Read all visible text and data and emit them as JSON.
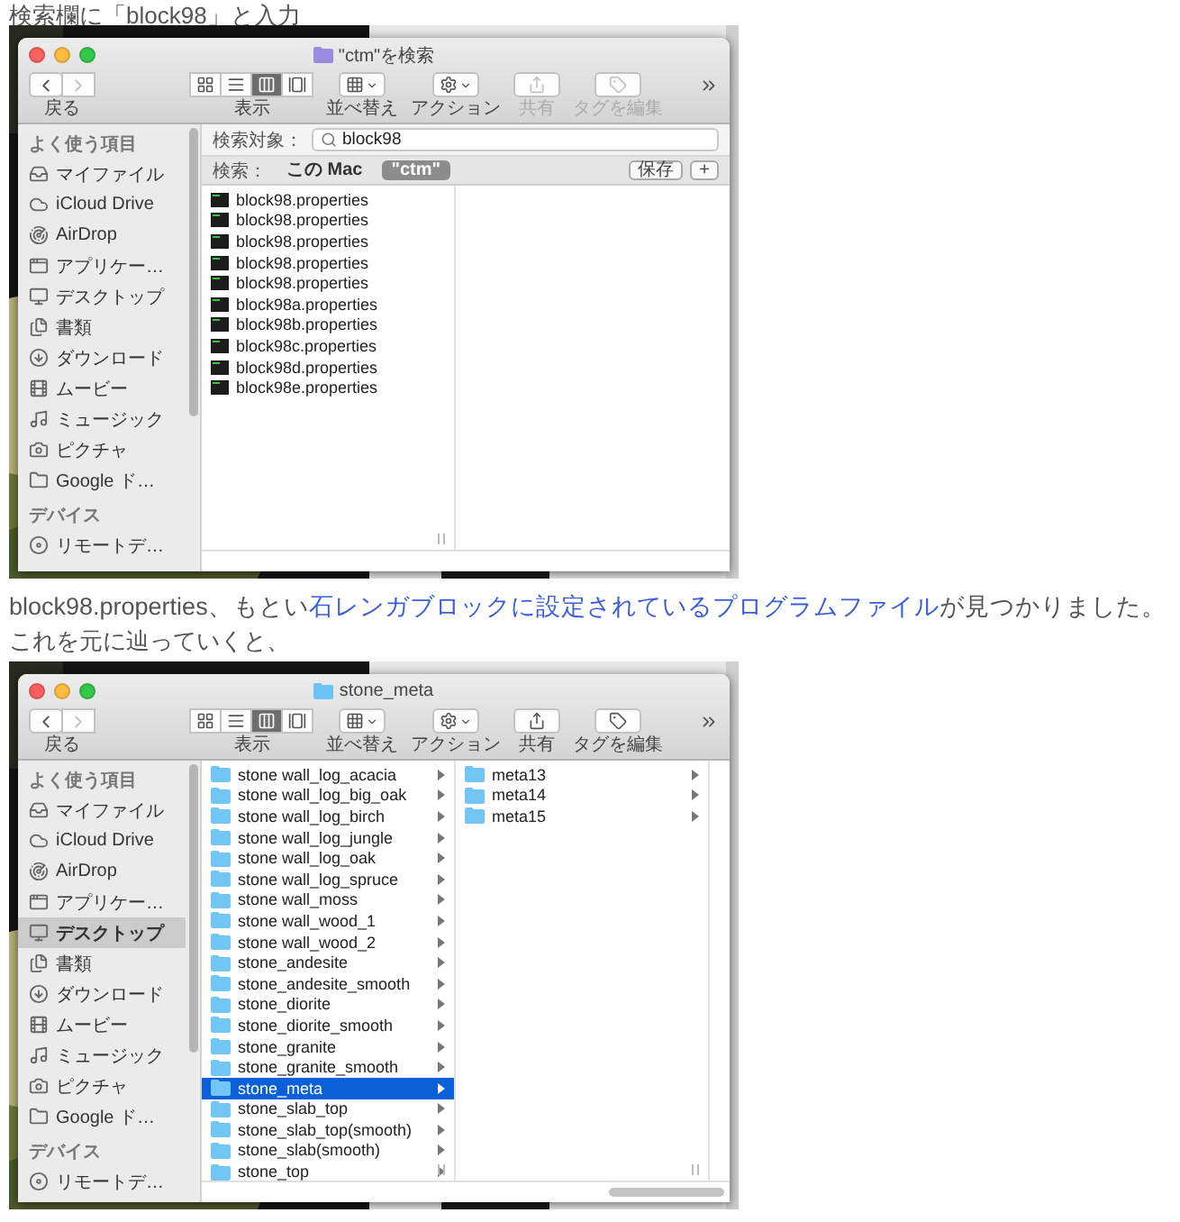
{
  "blocks": [
    {
      "kind": "text",
      "text": "検索欄に「block98」と入力"
    },
    {
      "kind": "finder",
      "window": {
        "title": "\"ctm\"を検索",
        "kind": "search"
      },
      "toolbar": {
        "back_label": "戻る",
        "forward_disabled": true,
        "view_label": "表示",
        "view_modes": [
          {
            "kind": "icon",
            "selected": false
          },
          {
            "kind": "list",
            "selected": false
          },
          {
            "kind": "column",
            "selected": true
          },
          {
            "kind": "gallery",
            "selected": false
          }
        ],
        "tools": [
          {
            "kind": "arrange",
            "label": "並べ替え",
            "disabled": false
          },
          {
            "kind": "action",
            "label": "アクション",
            "disabled": false
          },
          {
            "kind": "share",
            "label": "共有",
            "disabled": true
          },
          {
            "kind": "tag",
            "label": "タグを編集",
            "disabled": true
          }
        ]
      },
      "sidebar": [
        {
          "title": "よく使う項目",
          "items": [
            {
              "label": "マイファイル",
              "kind": "myfiles",
              "selected": false
            },
            {
              "label": "iCloud Drive",
              "kind": "icloud",
              "selected": false
            },
            {
              "label": "AirDrop",
              "kind": "airdrop",
              "selected": false
            },
            {
              "label": "アプリケー…",
              "kind": "apps",
              "selected": false
            },
            {
              "label": "デスクトップ",
              "kind": "desktop",
              "selected": false
            },
            {
              "label": "書類",
              "kind": "documents",
              "selected": false
            },
            {
              "label": "ダウンロード",
              "kind": "downloads",
              "selected": false
            },
            {
              "label": "ムービー",
              "kind": "movies",
              "selected": false
            },
            {
              "label": "ミュージック",
              "kind": "music",
              "selected": false
            },
            {
              "label": "ピクチャ",
              "kind": "pictures",
              "selected": false
            },
            {
              "label": "Google ド…",
              "kind": "folder",
              "selected": false
            }
          ]
        },
        {
          "title": "デバイス",
          "items": [
            {
              "label": "リモートデ…",
              "kind": "remote",
              "selected": false
            }
          ]
        }
      ],
      "search": {
        "label": "検索対象：",
        "value": "block98",
        "scope_label": "検索：",
        "scopes": [
          {
            "label": "この Mac",
            "selected": false
          },
          {
            "label": "\"ctm\"",
            "selected": true
          }
        ],
        "save": "保存",
        "add": "+"
      },
      "columns": [
        {
          "items": [
            {
              "name": "block98.properties",
              "kind": "file",
              "selected": false
            },
            {
              "name": "block98.properties",
              "kind": "file",
              "selected": false
            },
            {
              "name": "block98.properties",
              "kind": "file",
              "selected": false
            },
            {
              "name": "block98.properties",
              "kind": "file",
              "selected": false
            },
            {
              "name": "block98.properties",
              "kind": "file",
              "selected": false
            },
            {
              "name": "block98a.properties",
              "kind": "file",
              "selected": false
            },
            {
              "name": "block98b.properties",
              "kind": "file",
              "selected": false
            },
            {
              "name": "block98c.properties",
              "kind": "file",
              "selected": false
            },
            {
              "name": "block98d.properties",
              "kind": "file",
              "selected": false
            },
            {
              "name": "block98e.properties",
              "kind": "file",
              "selected": false
            }
          ]
        }
      ]
    },
    {
      "kind": "paragraph",
      "before": "block98.properties、もとい",
      "link": "石レンガブロックに設定されているプログラムファイル",
      "after": "が見つかりました。"
    },
    {
      "kind": "text",
      "text": "これを元に辿っていくと、"
    },
    {
      "kind": "finder",
      "window": {
        "title": "stone_meta",
        "kind": "folder"
      },
      "toolbar": {
        "back_label": "戻る",
        "forward_disabled": true,
        "view_label": "表示",
        "view_modes": [
          {
            "kind": "icon",
            "selected": false
          },
          {
            "kind": "list",
            "selected": false
          },
          {
            "kind": "column",
            "selected": true
          },
          {
            "kind": "gallery",
            "selected": false
          }
        ],
        "tools": [
          {
            "kind": "arrange",
            "label": "並べ替え",
            "disabled": false
          },
          {
            "kind": "action",
            "label": "アクション",
            "disabled": false
          },
          {
            "kind": "share",
            "label": "共有",
            "disabled": false
          },
          {
            "kind": "tag",
            "label": "タグを編集",
            "disabled": false
          }
        ]
      },
      "sidebar": [
        {
          "title": "よく使う項目",
          "items": [
            {
              "label": "マイファイル",
              "kind": "myfiles",
              "selected": false
            },
            {
              "label": "iCloud Drive",
              "kind": "icloud",
              "selected": false
            },
            {
              "label": "AirDrop",
              "kind": "airdrop",
              "selected": false
            },
            {
              "label": "アプリケー…",
              "kind": "apps",
              "selected": false
            },
            {
              "label": "デスクトップ",
              "kind": "desktop",
              "selected": true
            },
            {
              "label": "書類",
              "kind": "documents",
              "selected": false
            },
            {
              "label": "ダウンロード",
              "kind": "downloads",
              "selected": false
            },
            {
              "label": "ムービー",
              "kind": "movies",
              "selected": false
            },
            {
              "label": "ミュージック",
              "kind": "music",
              "selected": false
            },
            {
              "label": "ピクチャ",
              "kind": "pictures",
              "selected": false
            },
            {
              "label": "Google ド…",
              "kind": "folder",
              "selected": false
            }
          ]
        },
        {
          "title": "デバイス",
          "items": [
            {
              "label": "リモートデ…",
              "kind": "remote",
              "selected": false
            }
          ]
        }
      ],
      "columns": [
        {
          "items": [
            {
              "name": "stone wall_log_acacia",
              "kind": "folder",
              "selected": false
            },
            {
              "name": "stone wall_log_big_oak",
              "kind": "folder",
              "selected": false
            },
            {
              "name": "stone wall_log_birch",
              "kind": "folder",
              "selected": false
            },
            {
              "name": "stone wall_log_jungle",
              "kind": "folder",
              "selected": false
            },
            {
              "name": "stone wall_log_oak",
              "kind": "folder",
              "selected": false
            },
            {
              "name": "stone wall_log_spruce",
              "kind": "folder",
              "selected": false
            },
            {
              "name": "stone wall_moss",
              "kind": "folder",
              "selected": false
            },
            {
              "name": "stone wall_wood_1",
              "kind": "folder",
              "selected": false
            },
            {
              "name": "stone wall_wood_2",
              "kind": "folder",
              "selected": false
            },
            {
              "name": "stone_andesite",
              "kind": "folder",
              "selected": false
            },
            {
              "name": "stone_andesite_smooth",
              "kind": "folder",
              "selected": false
            },
            {
              "name": "stone_diorite",
              "kind": "folder",
              "selected": false
            },
            {
              "name": "stone_diorite_smooth",
              "kind": "folder",
              "selected": false
            },
            {
              "name": "stone_granite",
              "kind": "folder",
              "selected": false
            },
            {
              "name": "stone_granite_smooth",
              "kind": "folder",
              "selected": false
            },
            {
              "name": "stone_meta",
              "kind": "folder",
              "selected": true
            },
            {
              "name": "stone_slab_top",
              "kind": "folder",
              "selected": false
            },
            {
              "name": "stone_slab_top(smooth)",
              "kind": "folder",
              "selected": false
            },
            {
              "name": "stone_slab(smooth)",
              "kind": "folder",
              "selected": false
            },
            {
              "name": "stone_top",
              "kind": "folder",
              "selected": false
            }
          ]
        },
        {
          "items": [
            {
              "name": "meta13",
              "kind": "folder",
              "selected": false
            },
            {
              "name": "meta14",
              "kind": "folder",
              "selected": false
            },
            {
              "name": "meta15",
              "kind": "folder",
              "selected": false
            }
          ]
        }
      ]
    }
  ]
}
